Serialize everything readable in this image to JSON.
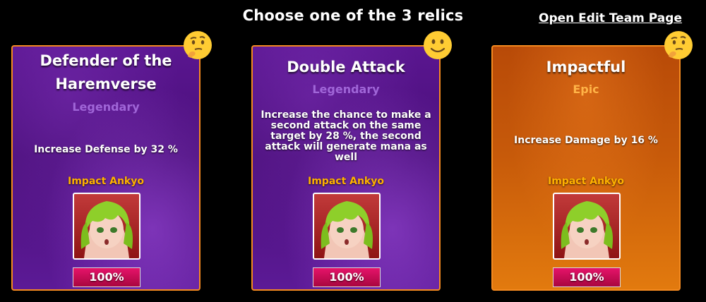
{
  "page": {
    "title": "Choose one of the 3 relics",
    "edit_link": "Open Edit Team Page"
  },
  "relics": [
    {
      "title_line1": "Defender of the",
      "title_line2": "Haremverse",
      "rarity": "Legendary",
      "description": "Increase Defense by 32 %",
      "hero_name": "Impact Ankyo",
      "hero_progress": "100%",
      "emoji": "thinking-face-icon"
    },
    {
      "title_line1": "Double Attack",
      "title_line2": "",
      "rarity": "Legendary",
      "description": "Increase the chance to make a second attack on the same target by 28 %, the second attack will generate mana as well",
      "hero_name": "Impact Ankyo",
      "hero_progress": "100%",
      "emoji": "smiling-face-icon"
    },
    {
      "title_line1": "Impactful",
      "title_line2": "",
      "rarity": "Epic",
      "description": "Increase Damage by 16 %",
      "hero_name": "Impact Ankyo",
      "hero_progress": "100%",
      "emoji": "thinking-face-icon"
    }
  ],
  "colors": {
    "card_border": "#f58a1f",
    "legendary_bg": "#4a0f7a",
    "epic_bg": "#c75a0a",
    "legendary_text": "#a066d8",
    "epic_text": "#ffb347",
    "hero_name_text": "#ffb200",
    "progress_bar": "#d90f5c"
  }
}
